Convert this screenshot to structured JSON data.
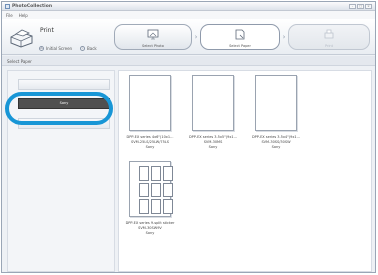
{
  "window": {
    "title": "PhotoCollection"
  },
  "menu": {
    "items": [
      "File",
      "Help"
    ]
  },
  "toolbar": {
    "print_label": "Print",
    "initial_screen_label": "Initial Screen",
    "back_label": "Back"
  },
  "steps": [
    {
      "label": "Select Photo",
      "state": "normal"
    },
    {
      "label": "Select Paper",
      "state": "active"
    },
    {
      "label": "Print",
      "state": "disabled"
    }
  ],
  "section": {
    "title": "Select Paper"
  },
  "makers": [
    {
      "label": "",
      "selected": false
    },
    {
      "label": "Sony",
      "selected": true
    },
    {
      "label": "",
      "selected": false
    }
  ],
  "papers": [
    {
      "name": "DPP-EX series 4x6\"(10x1...",
      "code": "SVM-25LS/25LW/75LS",
      "maker": "Sony",
      "type": "plain"
    },
    {
      "name": "DPP-EX series 3.5x5\"(9x1...",
      "code": "SVM-30MS",
      "maker": "Sony",
      "type": "plain"
    },
    {
      "name": "DPP-EX series 3.5x4\"(9x1...",
      "code": "SVM-30SS/30SW",
      "maker": "Sony",
      "type": "plain"
    },
    {
      "name": "DPP-EX series 9-split sticker",
      "code": "SVM-30SW9V",
      "maker": "Sony",
      "type": "sticker"
    }
  ],
  "colors": {
    "highlight_ring": "#1896d6",
    "selected_maker_bg": "#505050"
  },
  "icons": {
    "print": "printer-icon",
    "select_photo": "photo-frame-icon",
    "select_paper": "paper-icon",
    "print_step": "printer-small-icon"
  }
}
